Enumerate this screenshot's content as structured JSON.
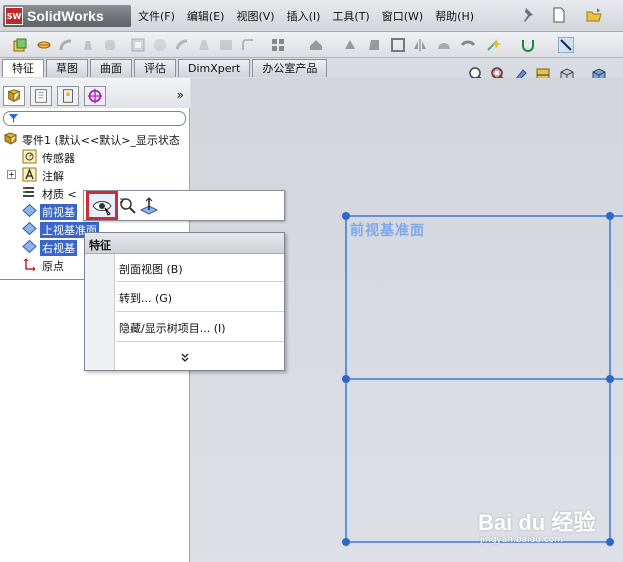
{
  "app": {
    "name": "SolidWorks",
    "logo_mark": "SW"
  },
  "menu": [
    "文件(F)",
    "编辑(E)",
    "视图(V)",
    "插入(I)",
    "工具(T)",
    "窗口(W)",
    "帮助(H)"
  ],
  "tabs": [
    {
      "label": "特征",
      "active": true
    },
    {
      "label": "草图",
      "active": false
    },
    {
      "label": "曲面",
      "active": false
    },
    {
      "label": "评估",
      "active": false
    },
    {
      "label": "DimXpert",
      "active": false
    },
    {
      "label": "办公室产品",
      "active": false
    }
  ],
  "feature_tree": {
    "expand_label": "»",
    "filter_icon": "filter-icon",
    "part_label": "零件1  (默认<<默认>_显示状态",
    "items": [
      {
        "label": "传感器",
        "icon": "sensor-icon",
        "selected": false,
        "expandable": false
      },
      {
        "label": "注解",
        "icon": "annotation-icon",
        "selected": false,
        "expandable": true
      },
      {
        "label": "材质 <",
        "icon": "material-icon",
        "selected": false,
        "expandable": false
      },
      {
        "label": "前视基",
        "icon": "plane-icon",
        "selected": true,
        "expandable": false
      },
      {
        "label": "上视基准面",
        "icon": "plane-icon",
        "selected": true,
        "expandable": false
      },
      {
        "label": "右视基",
        "icon": "plane-icon",
        "selected": true,
        "expandable": false
      },
      {
        "label": "原点",
        "icon": "origin-icon",
        "selected": false,
        "expandable": false
      }
    ]
  },
  "graphics": {
    "plane_label": "前视基准面",
    "accent": "#3c78d8"
  },
  "context_menu": {
    "title": "特征",
    "items": [
      "剖面视图 (B)",
      "转到... (G)",
      "隐藏/显示树项目... (I)"
    ],
    "more_label": "»"
  },
  "watermark": {
    "brand": "Bai du 经验",
    "sub": "jingyan.baidu.com"
  }
}
